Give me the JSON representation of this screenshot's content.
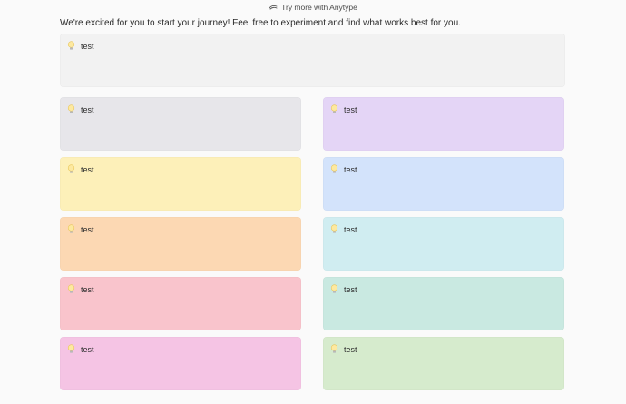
{
  "promo": {
    "label": "Try more with Anytype",
    "icon": "sparkle-icon"
  },
  "intro_text": "We're excited for you to start your journey! Feel free to experiment and find what works best for you.",
  "callouts": [
    {
      "id": "gray-full",
      "icon": "lightbulb-icon",
      "text": "test",
      "color": "#f2f2f2"
    },
    {
      "id": "gray",
      "icon": "lightbulb-icon",
      "text": "test",
      "color": "#e7e6ea"
    },
    {
      "id": "purple",
      "icon": "lightbulb-icon",
      "text": "test",
      "color": "#e4d5f6"
    },
    {
      "id": "yellow",
      "icon": "lightbulb-icon",
      "text": "test",
      "color": "#fdf0b9"
    },
    {
      "id": "blue",
      "icon": "lightbulb-icon",
      "text": "test",
      "color": "#d3e3fb"
    },
    {
      "id": "orange",
      "icon": "lightbulb-icon",
      "text": "test",
      "color": "#fcd8b3"
    },
    {
      "id": "teal",
      "icon": "lightbulb-icon",
      "text": "test",
      "color": "#d0edf1"
    },
    {
      "id": "red",
      "icon": "lightbulb-icon",
      "text": "test",
      "color": "#f9c4cc"
    },
    {
      "id": "green",
      "icon": "lightbulb-icon",
      "text": "test",
      "color": "#c9e9e1"
    },
    {
      "id": "pink",
      "icon": "lightbulb-icon",
      "text": "test",
      "color": "#f5c4e4"
    },
    {
      "id": "lime",
      "icon": "lightbulb-icon",
      "text": "test",
      "color": "#d6ebcd"
    }
  ]
}
